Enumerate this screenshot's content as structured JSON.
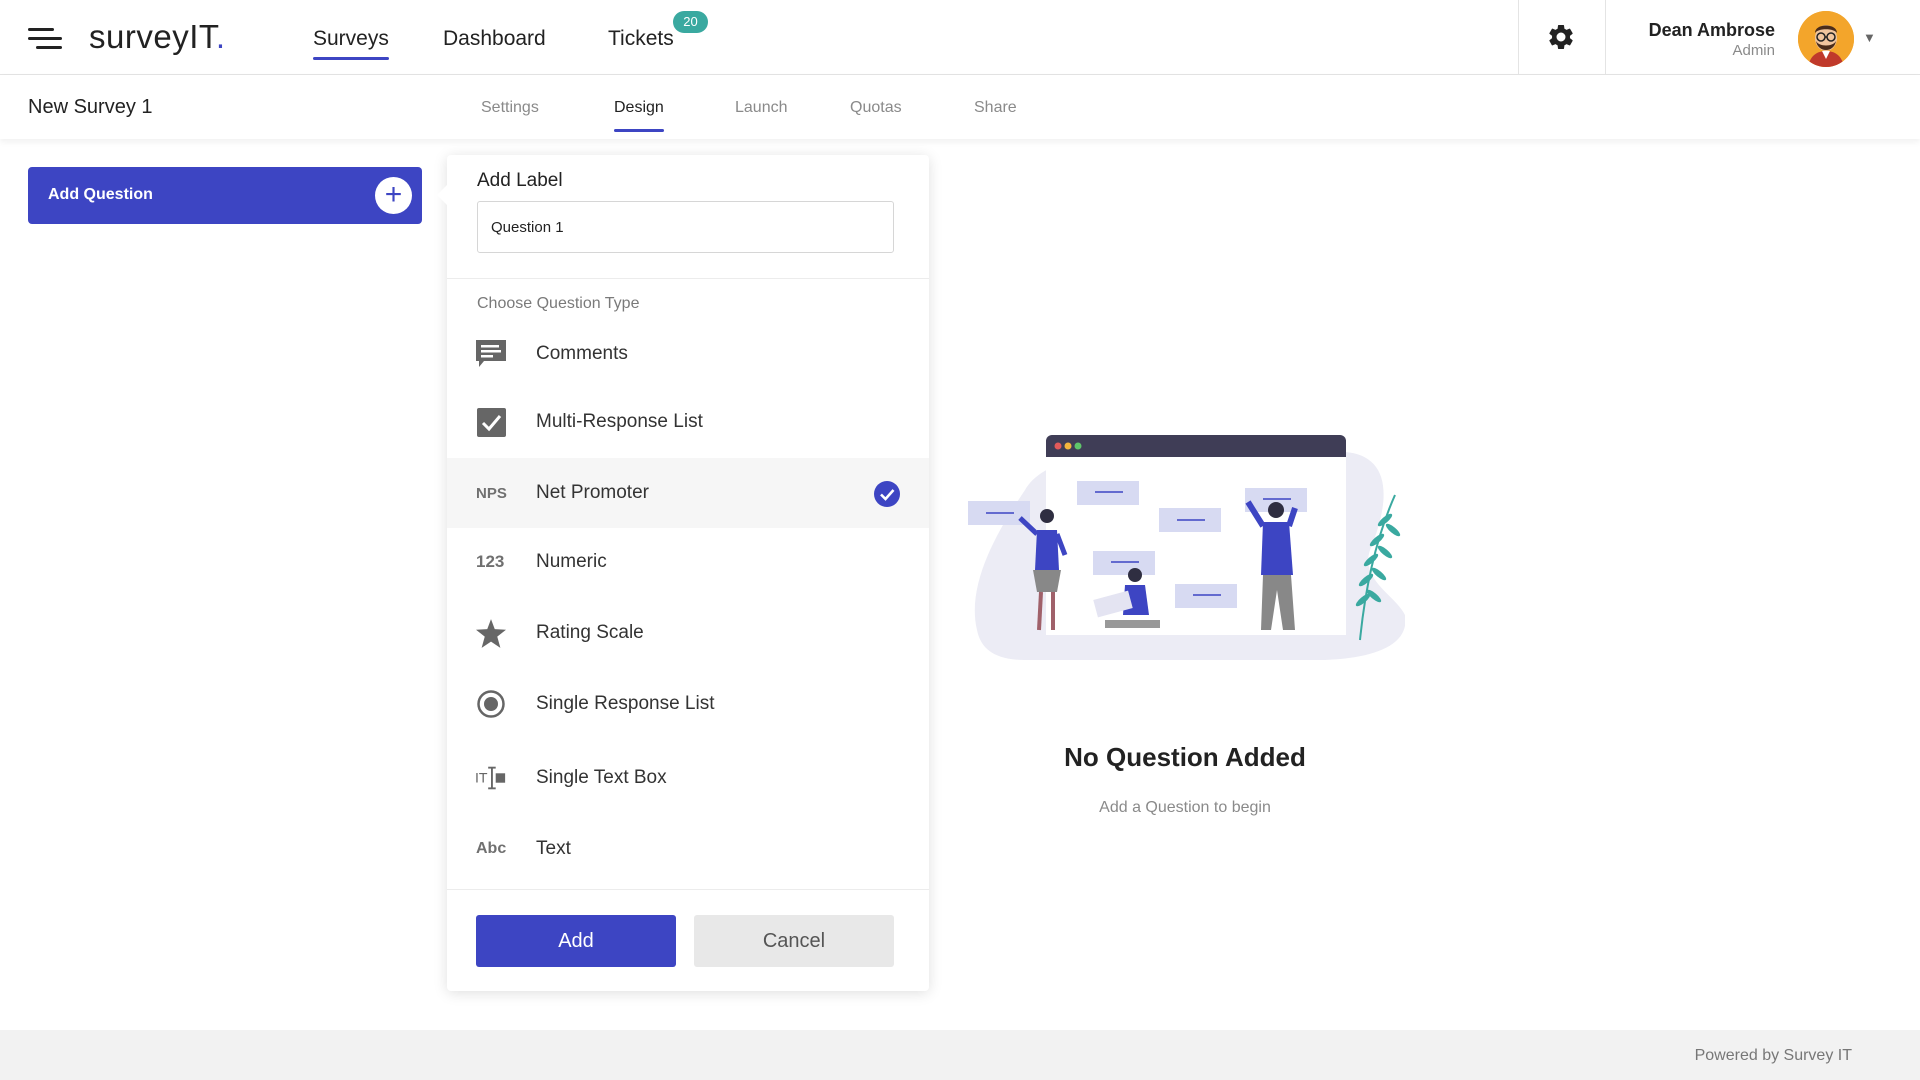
{
  "app": {
    "brand_main": "surveyIT",
    "brand_dot": ".",
    "nav": [
      {
        "label": "Surveys",
        "active": true
      },
      {
        "label": "Dashboard",
        "active": false
      },
      {
        "label": "Tickets",
        "active": false
      }
    ],
    "tickets_badge": "20",
    "user": {
      "name": "Dean Ambrose",
      "role": "Admin"
    },
    "icons": {
      "menu": "hamburger-icon",
      "settings": "gear-icon",
      "user_menu": "caret-down-icon"
    }
  },
  "survey": {
    "title": "New Survey 1",
    "tabs": [
      {
        "label": "Settings",
        "active": false
      },
      {
        "label": "Design",
        "active": true
      },
      {
        "label": "Launch",
        "active": false
      },
      {
        "label": "Quotas",
        "active": false
      },
      {
        "label": "Share",
        "active": false
      }
    ]
  },
  "sidebar": {
    "add_question_label": "Add Question",
    "add_question_icon": "plus-icon"
  },
  "panel": {
    "label_heading": "Add Label",
    "label_value": "Question 1",
    "choose_heading": "Choose Question Type",
    "question_types": [
      {
        "label": "Comments",
        "icon": "comment-icon",
        "selected": false
      },
      {
        "label": "Multi-Response List",
        "icon": "checkbox-icon",
        "selected": false
      },
      {
        "label": "Net Promoter",
        "icon_text": "NPS",
        "selected": true
      },
      {
        "label": "Numeric",
        "icon_text": "123",
        "selected": false
      },
      {
        "label": "Rating Scale",
        "icon": "star-icon",
        "selected": false
      },
      {
        "label": "Single Response List",
        "icon": "radio-icon",
        "selected": false
      },
      {
        "label": "Single Text Box",
        "icon": "text-box-icon",
        "selected": false
      },
      {
        "label": "Text",
        "icon_text": "Abc",
        "selected": false
      }
    ],
    "add_label": "Add",
    "cancel_label": "Cancel"
  },
  "empty_state": {
    "title": "No Question Added",
    "subtitle": "Add a Question to begin"
  },
  "footer": {
    "text": "Powered by Survey IT"
  },
  "colors": {
    "primary": "#3d45c3",
    "badge": "#3aa9a0",
    "footer_bg": "#f2f2f2"
  }
}
